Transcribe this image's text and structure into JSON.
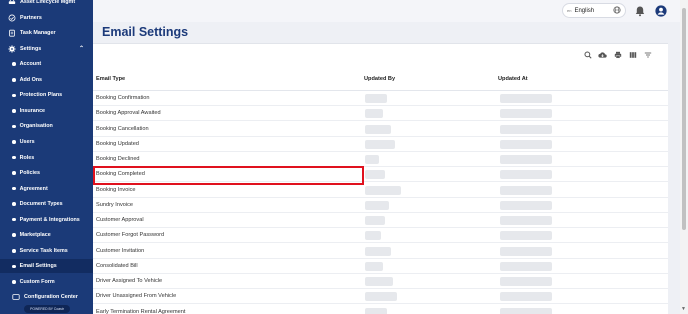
{
  "sidebar": {
    "items": [
      {
        "label": "Asset Lifecycle Mgmt",
        "icon": "car-icon",
        "type": "top"
      },
      {
        "label": "Partners",
        "icon": "handshake-icon",
        "type": "top"
      },
      {
        "label": "Task Manager",
        "icon": "clipboard-icon",
        "type": "top"
      },
      {
        "label": "Settings",
        "icon": "gear-icon",
        "type": "top",
        "expanded": true
      },
      {
        "label": "Account",
        "type": "sub"
      },
      {
        "label": "Add Ons",
        "type": "sub"
      },
      {
        "label": "Protection Plans",
        "type": "sub"
      },
      {
        "label": "Insurance",
        "type": "sub"
      },
      {
        "label": "Organisation",
        "type": "sub"
      },
      {
        "label": "Users",
        "type": "sub"
      },
      {
        "label": "Roles",
        "type": "sub"
      },
      {
        "label": "Policies",
        "type": "sub"
      },
      {
        "label": "Agreement",
        "type": "sub"
      },
      {
        "label": "Document Types",
        "type": "sub"
      },
      {
        "label": "Payment & Integrations",
        "type": "sub"
      },
      {
        "label": "Marketplace",
        "type": "sub"
      },
      {
        "label": "Service Task Items",
        "type": "sub"
      },
      {
        "label": "Email Settings",
        "type": "sub",
        "active": true
      },
      {
        "label": "Custom Form",
        "type": "sub"
      },
      {
        "label": "Configuration Center",
        "type": "sub-icon",
        "icon": "config-icon"
      }
    ],
    "powered_by": "POWERED BY Coastr"
  },
  "topbar": {
    "language": "English",
    "language_flag": "en"
  },
  "page": {
    "title": "Email Settings"
  },
  "table": {
    "columns": [
      "Email Type",
      "Updated By",
      "Updated At"
    ],
    "rows": [
      "Booking Confirmation",
      "Booking Approval Awaited",
      "Booking Cancellation",
      "Booking Updated",
      "Booking Declined",
      "Booking Completed",
      "Booking Invoice",
      "Sundry Invoice",
      "Customer Approval",
      "Customer Forgot Password",
      "Customer Invitation",
      "Consolidated Bill",
      "Driver Assigned To Vehicle",
      "Driver Unassigned From Vehicle",
      "Early Termination Rental Agreement"
    ],
    "highlighted_row": "Booking Completed"
  },
  "colors": {
    "sidebar_bg": "#1b3a78",
    "title": "#1c3a7a",
    "highlight": "#e0111e"
  }
}
